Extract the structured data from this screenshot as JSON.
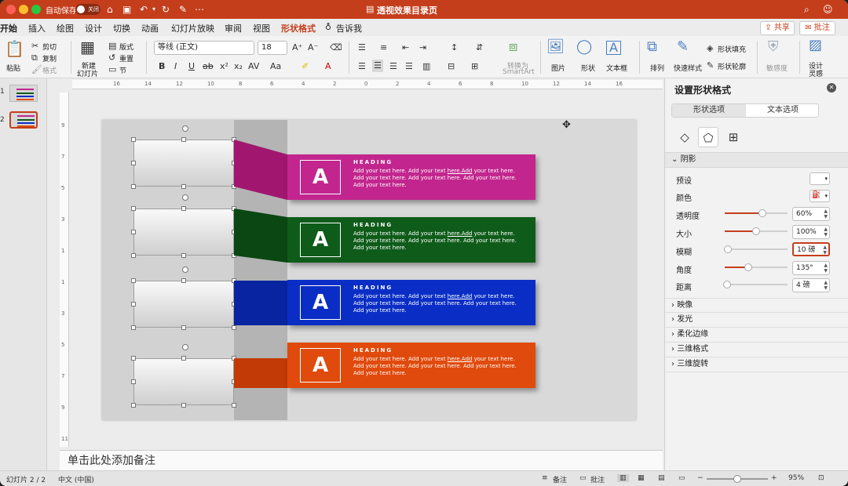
{
  "titlebar": {
    "autosave_label": "自动保存",
    "autosave_state": "关闭",
    "doc_title": "透视效果目录页"
  },
  "tabs": [
    "开始",
    "插入",
    "绘图",
    "设计",
    "切换",
    "动画",
    "幻灯片放映",
    "审阅",
    "视图",
    "形状格式",
    "告诉我"
  ],
  "tab_active": "开始",
  "share_label": "共享",
  "comment_label": "批注",
  "ribbon": {
    "paste": "粘贴",
    "cut": "剪切",
    "copy": "复制",
    "format": "格式",
    "new_slide": "新建",
    "new_slide_2": "幻灯片",
    "layout": "版式",
    "reset": "重置",
    "section": "节",
    "font_name": "等线 (正文)",
    "font_size": "18",
    "convert_smartart": "转换为",
    "convert_smartart_2": "SmartArt",
    "picture": "图片",
    "shape": "形状",
    "textbox": "文本框",
    "arrange": "排列",
    "quick_styles": "快速样式",
    "shape_fill": "形状填充",
    "shape_outline": "形状轮廓",
    "sensitivity": "敏感度",
    "designer": "设计",
    "designer_2": "灵感"
  },
  "thumbs": [
    "1",
    "2"
  ],
  "slide": {
    "items": [
      {
        "letter": "A",
        "heading": "HEADING",
        "text_a": "Add your text here. Add your text ",
        "text_link": "here.Add",
        "text_b": " your text here. Add your text here. Add your text here. Add your text here. Add your text here.",
        "color": "#c2268e",
        "fold": "#a1176f"
      },
      {
        "letter": "A",
        "heading": "HEADING",
        "text_a": "Add your text here. Add your text ",
        "text_link": "here.Add",
        "text_b": " your text here. Add your text here. Add your text here. Add your text here. Add your text here.",
        "color": "#0f5c1a",
        "fold": "#0a4712"
      },
      {
        "letter": "A",
        "heading": "HEADING",
        "text_a": "Add your text here. Add your text ",
        "text_link": "here.Add",
        "text_b": " your text here. Add your text here. Add your text here. Add your text here. Add your text here.",
        "color": "#0a2ec5",
        "fold": "#0824a0"
      },
      {
        "letter": "A",
        "heading": "HEADING",
        "text_a": "Add your text here. Add your text ",
        "text_link": "here.Add",
        "text_b": " your text here. Add your text here. Add your text here. Add your text here. Add your text here.",
        "color": "#e04a0c",
        "fold": "#c23a06"
      }
    ]
  },
  "notes_placeholder": "单击此处添加备注",
  "panel": {
    "title": "设置形状格式",
    "tab_shape": "形状选项",
    "tab_text": "文本选项",
    "section_shadow": "阴影",
    "preset": "预设",
    "color": "颜色",
    "transparency": {
      "label": "透明度",
      "value": "60%",
      "fraction": 0.6
    },
    "size": {
      "label": "大小",
      "value": "100%",
      "fraction": 0.5
    },
    "blur": {
      "label": "模糊",
      "value": "10 磅",
      "fraction": 0.05
    },
    "angle": {
      "label": "角度",
      "value": "135°",
      "fraction": 0.38
    },
    "distance": {
      "label": "距离",
      "value": "4 磅",
      "fraction": 0.04
    },
    "sections": [
      "映像",
      "发光",
      "柔化边缘",
      "三维格式",
      "三维旋转"
    ]
  },
  "status": {
    "slide_info": "幻灯片 2 / 2",
    "language": "中文 (中国)",
    "notes": "备注",
    "comments": "批注",
    "zoom": "95%"
  },
  "colors": {
    "accent": "#c43e1c"
  }
}
